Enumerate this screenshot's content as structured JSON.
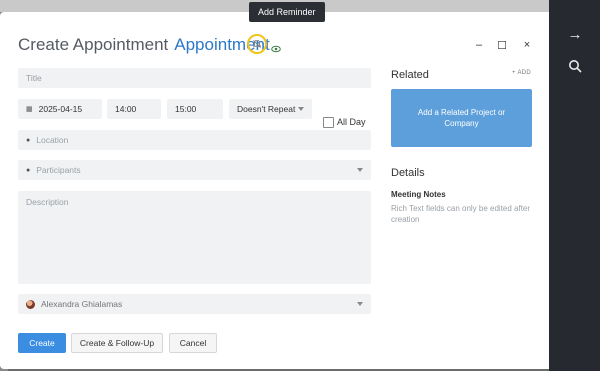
{
  "tooltip": {
    "text": "Add Reminder"
  },
  "header": {
    "title": "Create Appointment",
    "entity": "Appointment",
    "icons": {
      "reminder": "bell-slash-icon",
      "visibility": "eye-icon"
    },
    "window_controls": {
      "minimize": "–",
      "maximize": "☐",
      "close": "×"
    }
  },
  "form": {
    "title_placeholder": "Title",
    "date": "2025-04-15",
    "start_time": "14:00",
    "end_time": "15:00",
    "repeat": "Doesn't Repeat",
    "all_day_label": "All Day",
    "location_placeholder": "Location",
    "participants_placeholder": "Participants",
    "description_placeholder": "Description",
    "owner": "Alexandra Ghialamas"
  },
  "buttons": {
    "create": "Create",
    "create_follow_up": "Create & Follow-Up",
    "cancel": "Cancel"
  },
  "sidebar": {
    "related_heading": "Related",
    "add_link": "+ ADD",
    "related_box": "Add a Related Project or Company",
    "details_heading": "Details",
    "notes_label": "Meeting Notes",
    "notes_text": "Rich Text fields can only be edited after creation"
  },
  "rail": {
    "icons": [
      "arrow-right-icon",
      "search-icon"
    ]
  },
  "colors": {
    "accent": "#2d78c8",
    "primary_button": "#3a8de0",
    "highlight_ring": "#f0c419",
    "rail": "#262a30"
  }
}
